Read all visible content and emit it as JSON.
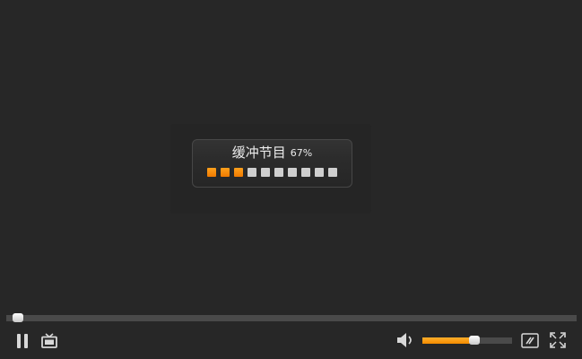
{
  "buffering": {
    "label": "缓冲节目",
    "percent_text": "67%",
    "progress": 0.67,
    "dots_total": 10,
    "dots_filled": 3
  },
  "playback": {
    "position_fraction": 0.02
  },
  "volume": {
    "level": 0.58
  },
  "icons": {
    "pause": "pause-icon",
    "tv": "tv-icon",
    "volume": "speaker-icon",
    "settings": "settings-icon",
    "fullscreen": "fullscreen-icon"
  },
  "colors": {
    "background": "#272727",
    "accent": "#f79c1c",
    "dot_inactive": "#cfcfcf",
    "track": "#4a4a4a"
  }
}
